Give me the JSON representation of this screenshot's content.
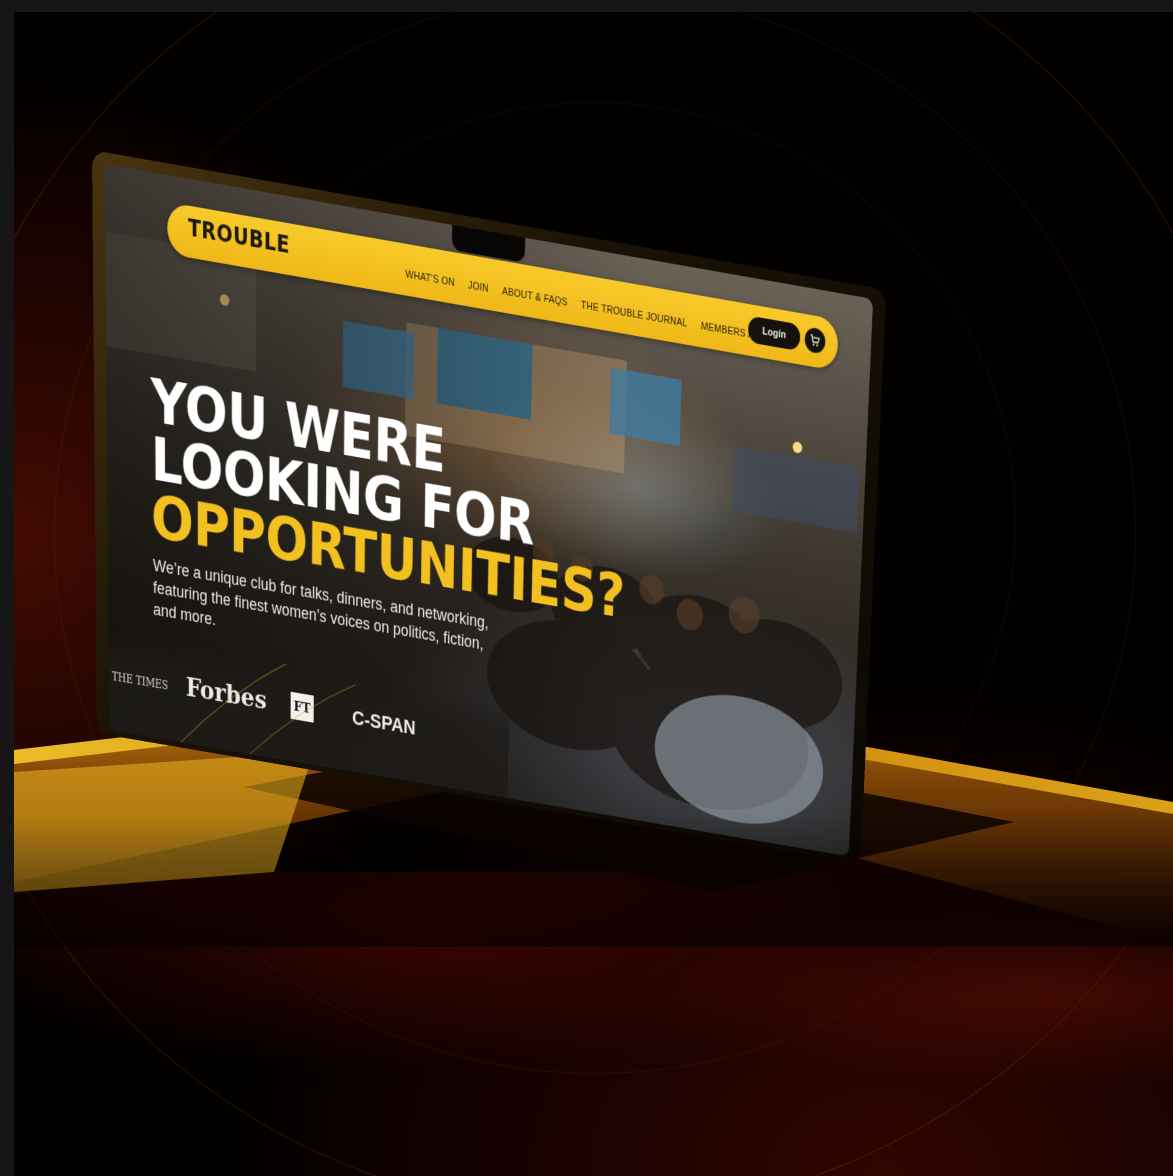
{
  "site": {
    "logo_text": "TROUBLE",
    "nav": {
      "items": [
        {
          "label": "WHAT'S ON"
        },
        {
          "label": "JOIN"
        },
        {
          "label": "ABOUT & FAQS"
        },
        {
          "label": "THE TROUBLE JOURNAL"
        },
        {
          "label": "MEMBERS AREA"
        }
      ],
      "login_label": "Login"
    },
    "hero": {
      "headline_line1": "YOU WERE",
      "headline_line2": "LOOKING FOR",
      "headline_accent": "OPPORTUNITIES?",
      "description": "We’re a unique club for talks, dinners, and networking, featuring the finest women’s voices on politics, fiction, and more."
    },
    "press": {
      "times": "THE TIMES",
      "forbes": "Forbes",
      "ft": "FT",
      "cspan": "C-SPAN"
    }
  },
  "colors": {
    "accent_yellow": "#f2c11f",
    "nav_text": "#1f1b14",
    "button_dark": "#15120e",
    "background": "#030000"
  },
  "icons": {
    "cart": "shopping-cart-icon"
  }
}
